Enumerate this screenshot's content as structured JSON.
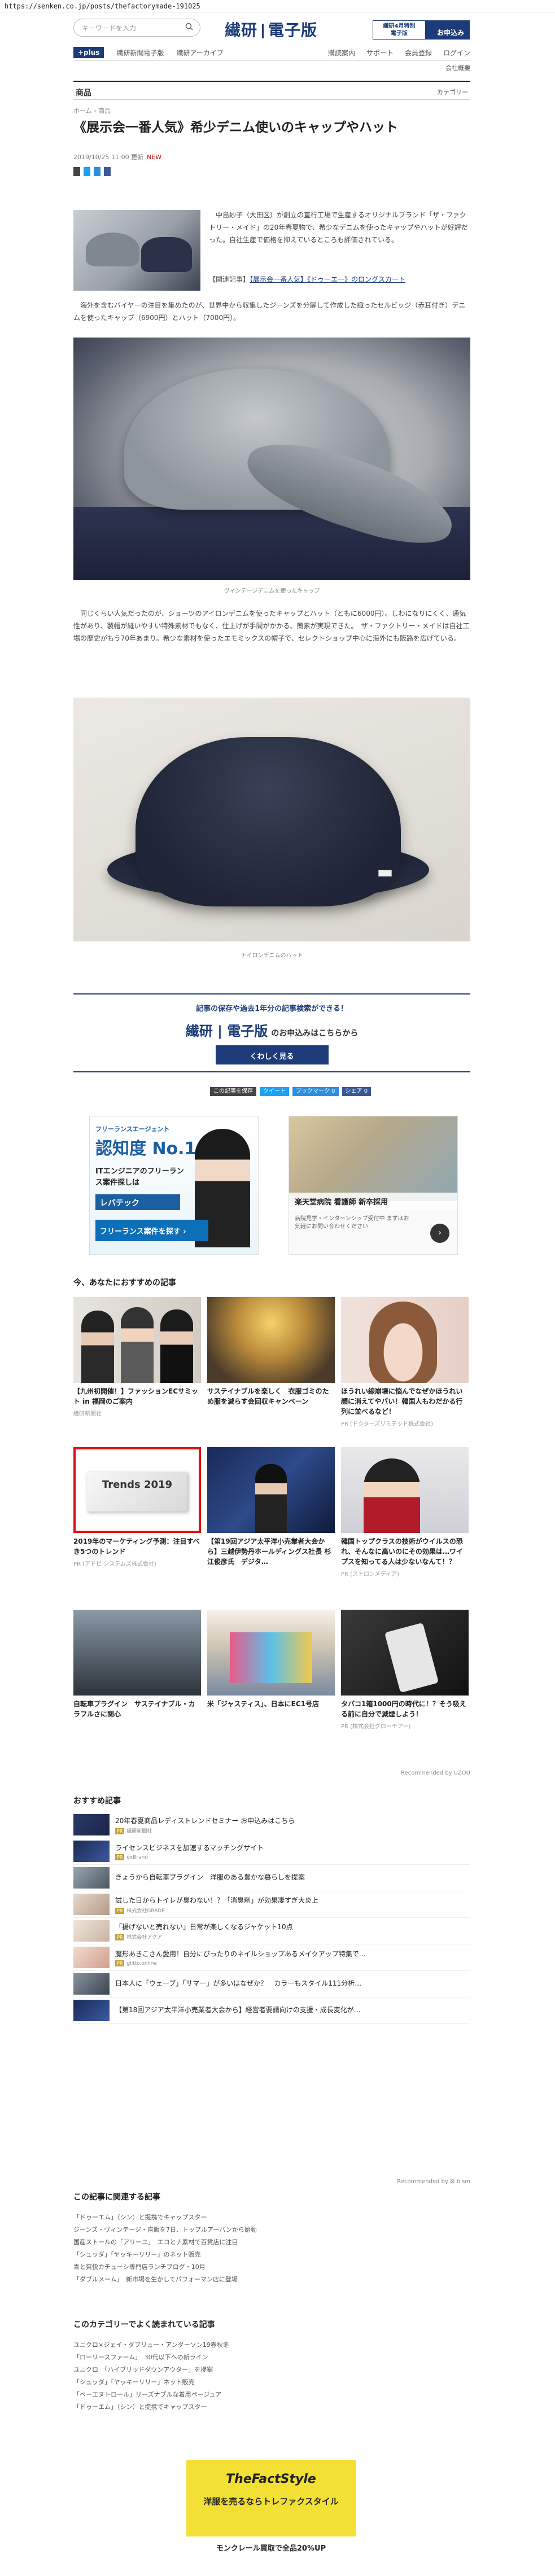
{
  "url": "https://senken.co.jp/posts/thefactorymade-191025",
  "header": {
    "search_placeholder": "キーワードを入力",
    "logo_left": "繊研",
    "logo_right": "電子版",
    "promo_top": "繊研4月特別",
    "promo_bottom": "電子版",
    "promo_btn": "お申込み"
  },
  "nav": {
    "plus": "+plus",
    "items": [
      "繊研新聞電子版",
      "繊研アーカイブ"
    ],
    "right": [
      "購読案内",
      "サポート",
      "会員登録",
      "ログイン"
    ],
    "sub": "会社概要"
  },
  "category": {
    "label": "商品",
    "select": "カテゴリー"
  },
  "article": {
    "breadcrumb": "ホーム › 商品",
    "title": "《展示会一番人気》希少デニム使いのキャップやハット",
    "date": "2019/10/25 11:00 更新",
    "badge": "NEW",
    "share": [
      "この記事を保存",
      "ツイート",
      "ブックマーク 0",
      "シェア 0"
    ],
    "intro": "中島紗子（大田区）が創立の直行工場で生産するオリジナルブランド「ザ・ファクトリー・メイド」の20年春夏物で、希少なデニムを使ったキャップやハットが好評だった。自社生産で価格を抑えているところも評価されている。",
    "related_label": "【関連記事】",
    "related_link": "【展示会一番人気】《ドゥーエ一》のロングスカート",
    "p2": "海外を含むバイヤーの注目を集めたのが、世界中から収集したジーンズを分解して作成した織ったセルビッジ（赤耳付き）デニムを使ったキャップ（6900円）とハット（7000円）。",
    "cap1": "ヴィンテージデニムを使ったキャップ",
    "p3": "同じくらい人気だったのが、ショーツのアイロンデニムを使ったキャップとハット（ともに6000円）。しわになりにくく、通気性があり、製帽が縫いやすい特殊素材でもなく、仕上げが手間がかかる、簡素が実現できた。　ザ・ファクトリー・メイドは自社工場の歴史がもう70年あまり。希少な素材を使ったエモミックスの帽子で、セレクトショップ中心に海外にも販路を広げている。",
    "cap2": "ナイロンデニムのハット"
  },
  "subscribe": {
    "title": "記事の保存や過去1年分の記事検索ができる！",
    "logo_left": "繊研",
    "logo_right": "電子版",
    "suffix": "のお申込みはこちらから",
    "btn": "くわしく見る"
  },
  "share2": [
    "この記事を保存",
    "ツイート",
    "ブックマーク 0",
    "シェア 0"
  ],
  "ads": {
    "ad1_a": "フリーランスエージェント",
    "ad1_b": "認知度 No.1",
    "ad1_c": "ITエンジニアのフリーランス案件探しは",
    "ad1_d": "レバテック",
    "ad1_e": "フリーランス案件を探す ›",
    "ad2_t": "楽天堂病院 看護師 新卒採用",
    "ad2_s": "病院見学・インターンシップ受付中 まずはお気軽にお問い合わせください"
  },
  "recommend": {
    "heading": "今、あなたにおすすめの記事",
    "by": "Recommended by UZOU",
    "cards": [
      {
        "title": "【九州初開催！】ファッションECサミット in 福岡のご案内",
        "src": "繊研新聞社"
      },
      {
        "title": "サステイナブルを楽しく　衣服ゴミのため服を減らす会回収キャンペーン",
        "src": ""
      },
      {
        "title": "ほうれい線崩壊に悩んでなぜかほうれい顔に消えてやバい！韓国人もわだかる行列に並べるなど！",
        "src": "PR (ドクターズリミテッド株式会社)"
      },
      {
        "title": "2019年のマーケティング予測：注目すべき5つのトレンド",
        "src": "PR (アドビ システムズ株式会社)",
        "img": "Trends 2019"
      },
      {
        "title": "【第19回アジア太平洋小売業者大会から】三越伊勢丹ホールディングス社長 杉江俊彦氏　デジタ…",
        "src": ""
      },
      {
        "title": "韓国トップクラスの技術がウイルスの恐れ、そんなに高いのにその効果は…ワイプスを知ってる人は少ないなんて！？",
        "src": "PR (ストロンメディア)"
      },
      {
        "title": "自転車プラグイン　サステイナブル・カラフルさに関心",
        "src": ""
      },
      {
        "title": "米「ジャスティス」、日本にEC1号店",
        "src": ""
      },
      {
        "title": "タバコ1箱1000円の時代に！？そう吸える前に自分で減煙しよう！",
        "src": "PR (株式会社グローチアー)"
      }
    ]
  },
  "osusume": {
    "heading": "おすすめ記事",
    "by": "Recommended by ⊠ b.sm",
    "rows": [
      {
        "title": "20年春夏商品レディストレンドセミナー お申込みはこちら",
        "sp": "繊研新聞社"
      },
      {
        "title": "ライセンスビジネスを加速するマッチングサイト",
        "sp": "exBrand"
      },
      {
        "title": "きょうから自転車プラグイン　洋服のある豊かな暮らしを提案",
        "sp": ""
      },
      {
        "title": "試した日からトイレが臭わない！？「消臭剤」が効果凄すぎ大炎上",
        "sp": "株式会社GRADE"
      },
      {
        "title": "「揚げないと売れない」日常が楽しくなるジャケット10点",
        "sp": "株式会社アクア"
      },
      {
        "title": "魔形あきこさん愛用！自分にぴったりのネイルショップあるメイクアップ特集で…",
        "sp": "glitto.online"
      },
      {
        "title": "日本人に「ウェーブ」「サマー」が多いはなぜか？　カラーもスタイル111分析…",
        "sp": ""
      },
      {
        "title": "【第18回アジア太平洋小売業者大会から】経営者要請向けの支援・成長変化が…",
        "sp": ""
      }
    ]
  },
  "related_articles": {
    "heading": "この記事に関連する記事",
    "links": [
      "「ドゥーエム」（シン）と提携でキャップスター",
      "ジーンズ・ヴィンテージ・直販を7日、トップルアーバンから始動",
      "国産ストールの「アリーユ」　エコとナ素材で百貨店に注目",
      "「シュッダ」「ヤッキーリリー」のネット販売",
      "青と爽快カチューシ専門店ランチブログ・10月",
      "「ダブルメーム」　新市場を生かしてパフォーマン店に登場"
    ]
  },
  "category_popular": {
    "heading": "このカテゴリーでよく読まれている記事",
    "links": [
      "ユニクロ×ジェイ・ダブリュー・アンダーソン19春秋冬",
      "「ローリースファーム」　30代以下への新ライン",
      "ユニクロ　「ハイブリッドダウンアウター」を提案",
      "「シュッダ」「ヤッキーリリー」ネット販売",
      "「ベーエヌトロール」リーズナブルな着用ページュア",
      "「ドゥーエム」（シン）と提携でキャップスター"
    ]
  },
  "bottom_ad": {
    "logo": "TheFactStyle",
    "title": "洋服を売るならトレファクスタイル",
    "footer": "モンクレール買取で全品20%UP"
  }
}
